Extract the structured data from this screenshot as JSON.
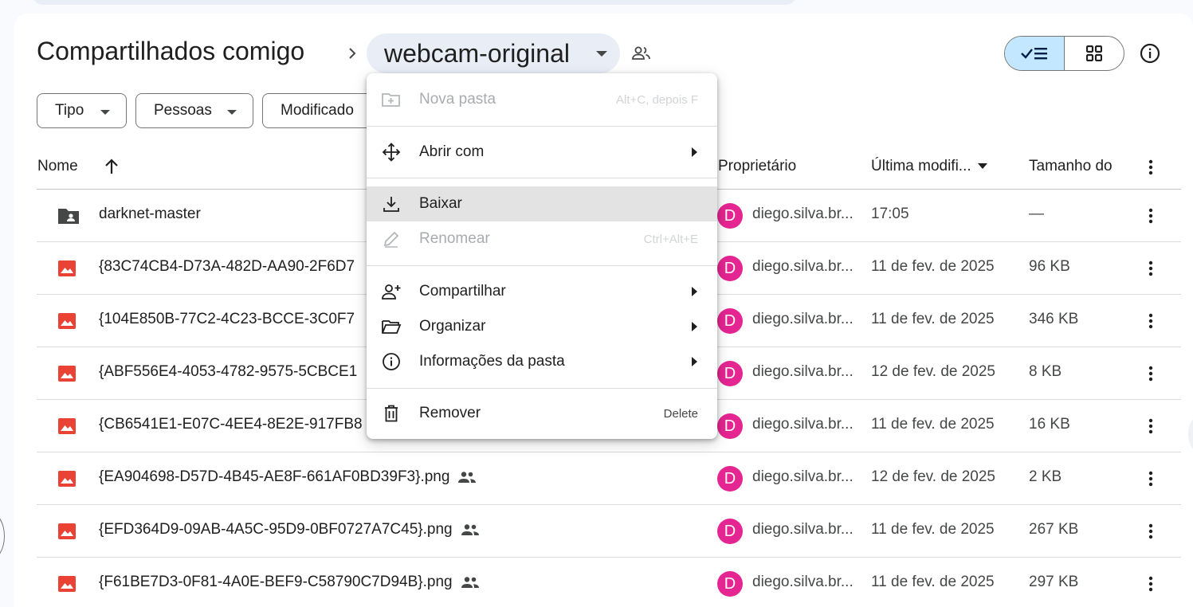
{
  "breadcrumb": {
    "root": "Compartilhados comigo",
    "current": "webcam-original"
  },
  "icons": {
    "shared": "people-icon",
    "list_view": "list-check-icon",
    "grid_view": "grid-icon",
    "info": "info-icon"
  },
  "filters": [
    "Tipo",
    "Pessoas",
    "Modificado"
  ],
  "columns": {
    "name": "Nome",
    "owner": "Proprietário",
    "modified": "Última modifi...",
    "size": "Tamanho do"
  },
  "rows": [
    {
      "name": "darknet-master",
      "owner": "diego.silva.br...",
      "modified": "17:05",
      "size": "—",
      "type": "folder",
      "shared": false
    },
    {
      "name": "{83C74CB4-D73A-482D-AA90-2F6D7",
      "owner": "diego.silva.br...",
      "modified": "11 de fev. de 2025",
      "size": "96 KB",
      "type": "image",
      "shared": false
    },
    {
      "name": "{104E850B-77C2-4C23-BCCE-3C0F7",
      "owner": "diego.silva.br...",
      "modified": "11 de fev. de 2025",
      "size": "346 KB",
      "type": "image",
      "shared": false
    },
    {
      "name": "{ABF556E4-4053-4782-9575-5CBCE1",
      "owner": "diego.silva.br...",
      "modified": "12 de fev. de 2025",
      "size": "8 KB",
      "type": "image",
      "shared": false
    },
    {
      "name": "{CB6541E1-E07C-4EE4-8E2E-917FB8",
      "owner": "diego.silva.br...",
      "modified": "11 de fev. de 2025",
      "size": "16 KB",
      "type": "image",
      "shared": false
    },
    {
      "name": "{EA904698-D57D-4B45-AE8F-661AF0BD39F3}.png",
      "owner": "diego.silva.br...",
      "modified": "12 de fev. de 2025",
      "size": "2 KB",
      "type": "image",
      "shared": true
    },
    {
      "name": "{EFD364D9-09AB-4A5C-95D9-0BF0727A7C45}.png",
      "owner": "diego.silva.br...",
      "modified": "11 de fev. de 2025",
      "size": "267 KB",
      "type": "image",
      "shared": true
    },
    {
      "name": "{F61BE7D3-0F81-4A0E-BEF9-C58790C7D94B}.png",
      "owner": "diego.silva.br...",
      "modified": "11 de fev. de 2025",
      "size": "297 KB",
      "type": "image",
      "shared": true
    }
  ],
  "avatar_letter": "D",
  "menu": {
    "items": [
      {
        "label": "Nova pasta",
        "shortcut": "Alt+C, depois F",
        "icon": "new-folder-icon",
        "disabled": true
      },
      {
        "label": "Abrir com",
        "icon": "move-icon",
        "submenu": true
      },
      {
        "label": "Baixar",
        "icon": "download-icon",
        "highlighted": true
      },
      {
        "label": "Renomear",
        "shortcut": "Ctrl+Alt+E",
        "icon": "pencil-icon",
        "disabled": true
      },
      {
        "label": "Compartilhar",
        "icon": "person-add-icon",
        "submenu": true
      },
      {
        "label": "Organizar",
        "icon": "folder-open-icon",
        "submenu": true
      },
      {
        "label": "Informações da pasta",
        "icon": "info-icon",
        "submenu": true
      },
      {
        "label": "Remover",
        "shortcut": "Delete",
        "icon": "trash-icon"
      }
    ]
  },
  "colors": {
    "accent_toggle": "#c2e7ff",
    "avatar": "#e52592",
    "image_icon": "#ea4335",
    "menu_highlight": "#e3e3e3"
  }
}
